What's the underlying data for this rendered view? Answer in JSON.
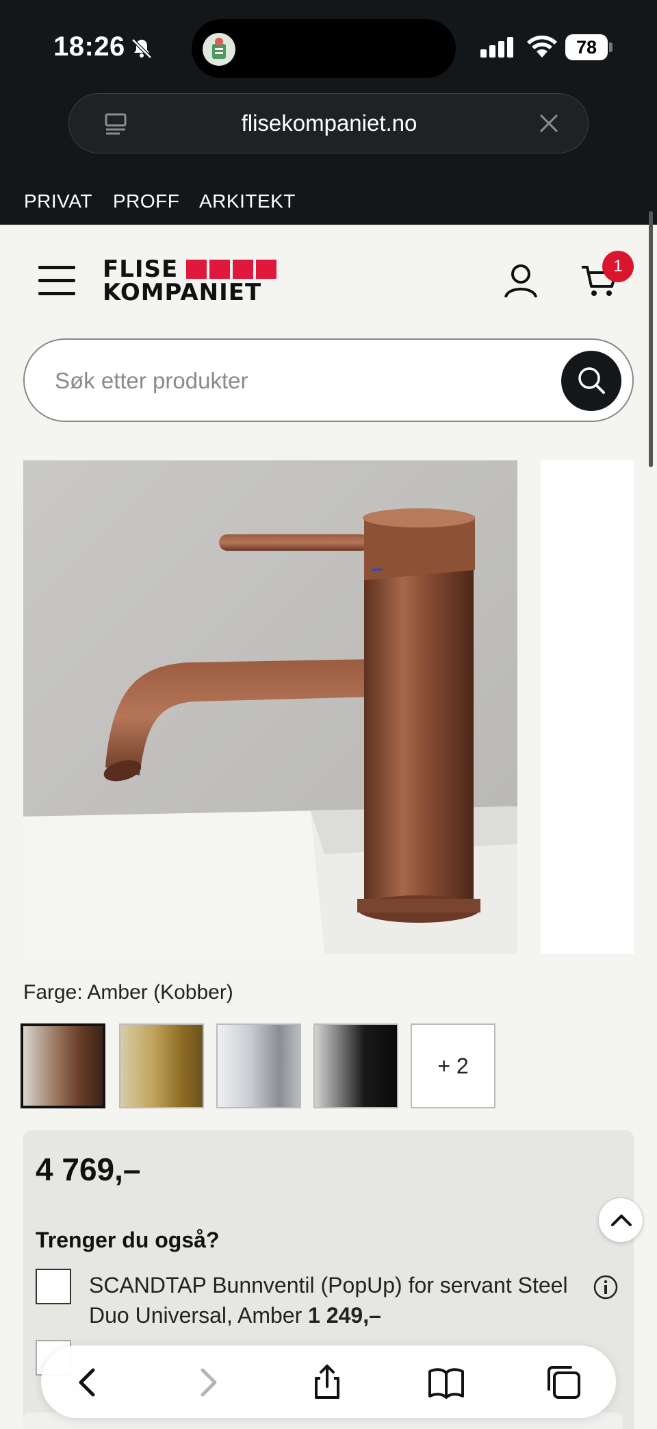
{
  "status_bar": {
    "time": "18:26",
    "battery": "78"
  },
  "browser": {
    "url": "flisekompaniet.no"
  },
  "top_nav": [
    "PRIVAT",
    "PROFF",
    "ARKITEKT"
  ],
  "header": {
    "logo_line1": "FLISE",
    "logo_line2": "KOMPANIET",
    "cart_count": "1"
  },
  "search": {
    "placeholder": "Søk etter produkter"
  },
  "product": {
    "color_label": "Farge: Amber (Kobber)",
    "swatches": [
      "amber",
      "gold",
      "chrome",
      "black"
    ],
    "more_swatches": "+ 2",
    "price": "4 769,–"
  },
  "addons": {
    "title": "Trenger du også?",
    "item1_name": "SCANDTAP Bunnventil (PopUp) for servant Steel Duo Universal, Amber",
    "item1_price": "1 249,–"
  },
  "colors": {
    "brand_red": "#e0183c",
    "dark": "#141719"
  }
}
